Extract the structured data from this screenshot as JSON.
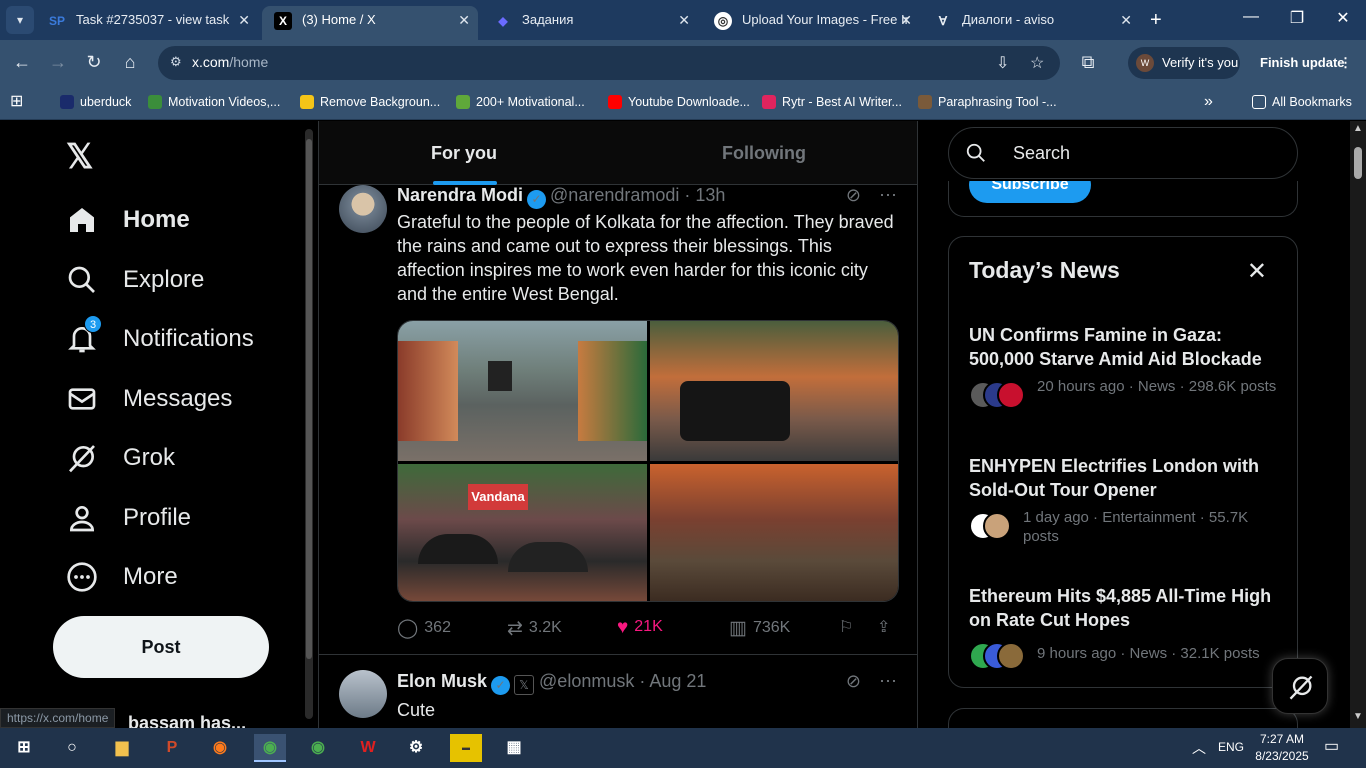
{
  "browser": {
    "tabs": [
      {
        "favicon": "SP",
        "title": "Task #2735037 - view task",
        "active": false
      },
      {
        "favicon": "X",
        "title": "(3) Home / X",
        "active": true
      },
      {
        "favicon": "◆",
        "title": "Задания",
        "active": false
      },
      {
        "favicon": "◎",
        "title": "Upload Your Images - Free Ir",
        "active": false
      },
      {
        "favicon": "∀",
        "title": "Диалоги - aviso",
        "active": false
      }
    ],
    "url_domain": "x.com",
    "url_path": "/home",
    "verify_label": "Verify it's you",
    "verify_avatar": "W",
    "finish_update_label": "Finish update",
    "bookmarks": [
      {
        "label": "uberduck",
        "color": "#1a2b6b"
      },
      {
        "label": "Motivation Videos,...",
        "color": "#3b8e3b"
      },
      {
        "label": "Remove Backgroun...",
        "color": "#f5c518"
      },
      {
        "label": "200+ Motivational...",
        "color": "#5fa83a"
      },
      {
        "label": "Youtube Downloade...",
        "color": "#ff0000"
      },
      {
        "label": "Rytr - Best AI Writer...",
        "color": "#e0245e"
      },
      {
        "label": "Paraphrasing Tool -...",
        "color": "#7a5a3a"
      }
    ],
    "all_bookmarks_label": "All Bookmarks",
    "status_url": "https://x.com/home"
  },
  "sidebar": {
    "logo": "𝕏",
    "items": [
      {
        "label": "Home",
        "icon": "home-icon"
      },
      {
        "label": "Explore",
        "icon": "search-icon"
      },
      {
        "label": "Notifications",
        "icon": "bell-icon",
        "badge": "3"
      },
      {
        "label": "Messages",
        "icon": "envelope-icon"
      },
      {
        "label": "Grok",
        "icon": "grok-icon"
      },
      {
        "label": "Profile",
        "icon": "person-icon"
      },
      {
        "label": "More",
        "icon": "more-circle-icon"
      }
    ],
    "post_label": "Post",
    "user_name": "bassam has..."
  },
  "feed": {
    "tabs": [
      "For you",
      "Following"
    ],
    "tweets": [
      {
        "name": "Narendra Modi",
        "handle": "@narendramodi",
        "time": "· 13h",
        "text": "Grateful to the people of Kolkata for the affection. They braved the rains and came out to express their blessings. This affection inspires me to work even harder for this iconic city and the entire West Bengal.",
        "media_sign": "Vandana",
        "replies": "362",
        "reposts": "3.2K",
        "likes": "21K",
        "views": "736K"
      },
      {
        "name": "Elon Musk",
        "handle": "@elonmusk",
        "time": "· Aug 21",
        "text": "Cute"
      }
    ]
  },
  "right": {
    "search_placeholder": "Search",
    "subscribe_label": "Subscribe",
    "news_title": "Today’s News",
    "news": [
      {
        "title": "UN Confirms Famine in Gaza: 500,000 Starve Amid Aid Blockade",
        "meta": "20 hours ago · News · 298.6K posts"
      },
      {
        "title": "ENHYPEN Electrifies London with Sold-Out Tour Opener",
        "meta": "1 day ago · Entertainment · 55.7K posts"
      },
      {
        "title": "Ethereum Hits $4,885 All-Time High on Rate Cut Hopes",
        "meta": "9 hours ago · News · 32.1K posts"
      }
    ]
  },
  "taskbar": {
    "language": "ENG",
    "time": "7:27 AM",
    "date": "8/23/2025"
  }
}
